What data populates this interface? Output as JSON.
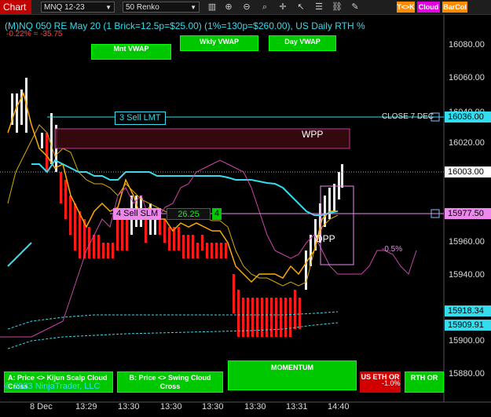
{
  "window": {
    "tab_label": "Chart"
  },
  "toolbar": {
    "instrument": "MNQ 12-23",
    "bar_type": "50 Renko",
    "icons": [
      "bars-icon",
      "zoom-in-icon",
      "zoom-out-icon",
      "search-icon",
      "crosshair-icon",
      "pointer-icon",
      "properties-icon",
      "link-icon",
      "marker-icon"
    ],
    "buttons": [
      {
        "label": "T<>K",
        "color": "#ff8c00"
      },
      {
        "label": "Cloud",
        "color": "#e000e0"
      },
      {
        "label": "BarCol",
        "color": "#ff8c00"
      }
    ]
  },
  "header": {
    "title": "(M)NQ 050 RE May 20 (1 Brick=12.5p=$25.00) (1%=130p=$260.00), US Daily RTH %",
    "subtitle": "-0.22% = -35.75"
  },
  "vwap_buttons": {
    "mnt": "Mnt VWAP",
    "wkly": "Wkly VWAP",
    "day": "Day VWAP"
  },
  "orders": {
    "sell_lmt": "3 Sell LMT",
    "sell_slm": "4 Sell SLM",
    "slm_price": "26.25",
    "slm_qty": "4",
    "close_label": "CLOSE 7 DEC",
    "close_icon": "x-icon"
  },
  "labels": {
    "wpp": "WPP",
    "dpp": "DPP",
    "pct": "-0.5%",
    "eth_pct": "-1.0%"
  },
  "price_axis": {
    "ticks": [
      "16080.00",
      "16060.00",
      "16040.00",
      "16020.00",
      "15960.00",
      "15940.00",
      "15900.00",
      "15880.00"
    ],
    "tags": [
      {
        "value": "16036.00",
        "color": "#33ddee"
      },
      {
        "value": "16003.00",
        "color": "#ffffff"
      },
      {
        "value": "15977.50",
        "color": "#ee88ee"
      },
      {
        "value": "15918.34",
        "color": "#33ddee"
      },
      {
        "value": "15909.91",
        "color": "#33ddee"
      }
    ]
  },
  "time_axis": [
    "8 Dec",
    "13:29",
    "13:30",
    "13:30",
    "13:30",
    "13:30",
    "13:31",
    "14:40"
  ],
  "bottom_buttons": {
    "a_cross": "A: Price <> Kijun Scalp Cloud Cross",
    "b_cross": "B: Price <> Swing Cloud Cross",
    "momentum": "MOMENTUM",
    "us_eth": "US ETH OR",
    "rth": "RTH OR",
    "copyright": "© 2023 NinjaTrader, LLC"
  }
}
